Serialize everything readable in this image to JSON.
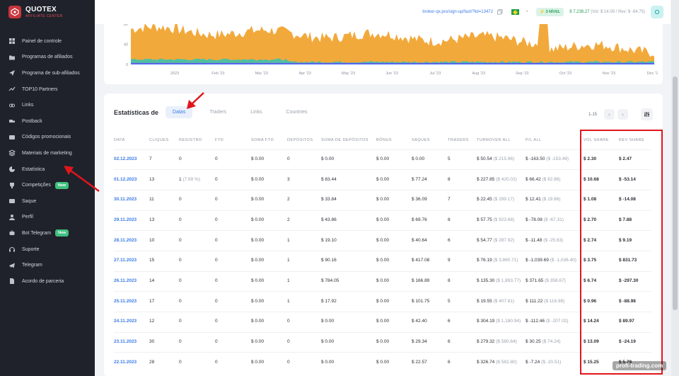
{
  "app": {
    "name": "QUOTEX",
    "subtitle": "AFFILIATE CENTER",
    "accent": "#c8353c"
  },
  "sidebar": {
    "items": [
      {
        "label": "Painel de controle",
        "icon": "dashboard-icon"
      },
      {
        "label": "Programas de afiliados",
        "icon": "folder-icon"
      },
      {
        "label": "Programa de sub-afiliados",
        "icon": "send-icon"
      },
      {
        "label": "TOP10 Partners",
        "icon": "trend-icon"
      },
      {
        "label": "Links",
        "icon": "link-icon"
      },
      {
        "label": "Postback",
        "icon": "truck-icon"
      },
      {
        "label": "Códigos promocionais",
        "icon": "promo-icon"
      },
      {
        "label": "Materiais de marketing",
        "icon": "stack-icon"
      },
      {
        "label": "Estatística",
        "icon": "pie-chart-icon"
      },
      {
        "label": "Competições",
        "icon": "trophy-icon",
        "badge": "New"
      },
      {
        "label": "Saque",
        "icon": "wallet-icon"
      },
      {
        "label": "Perfil",
        "icon": "user-icon"
      },
      {
        "label": "Bot Telegram",
        "icon": "bot-icon",
        "badge": "New"
      },
      {
        "label": "Suporte",
        "icon": "headset-icon"
      },
      {
        "label": "Telegram",
        "icon": "telegram-icon"
      },
      {
        "label": "Acordo de parceria",
        "icon": "document-icon"
      }
    ]
  },
  "topbar": {
    "ref_link": "broker-qx.pro/sign-up/fast/?lid=13472",
    "level": "3 NÍVEL",
    "balance": "$ 7,238.27",
    "balance_detail": "(Vol: $ 14.09 / Rev: $ -84.75)"
  },
  "chart_data": {
    "type": "area",
    "y_ticks": [
      "80",
      "40",
      "0"
    ],
    "ylim": [
      0,
      80
    ],
    "x_labels": [
      "2023",
      "Feb '23",
      "Mar '23",
      "Apr '23",
      "May '23",
      "Jun '23",
      "Jul '23",
      "Aug '23",
      "Sep '23",
      "Oct '23",
      "Nov '23",
      "Dec '2"
    ],
    "colors": {
      "orange": "#f2a93b",
      "teal": "#34c3b5",
      "purple": "#7a5fd6",
      "blue": "#3d6bff"
    }
  },
  "table": {
    "title": "Estatísticas de",
    "tabs": [
      "Datas",
      "Traders",
      "Links",
      "Countries"
    ],
    "pagination": "1-15",
    "columns": [
      "DATA",
      "CLIQUES",
      "REGISTRO",
      "FTD",
      "SOMA FTD",
      "DEPÓSITOS",
      "SOMA DE DEPÓSITOS",
      "BÔNUS",
      "SAQUES",
      "TRADERS",
      "TURNOVER ALL",
      "P/L ALL",
      "VOL SHARE",
      "REV SHARE"
    ],
    "rows": [
      {
        "date": "02.12.2023",
        "cliques": "7",
        "registro": "0",
        "registro_pct": "",
        "ftd": "0",
        "soma_ftd": "$ 0.00",
        "depositos": "0",
        "soma_dep": "$ 0.00",
        "bonus": "$ 0.00",
        "saques": "$ 0.00",
        "traders": "5",
        "turnover": "$ 50.54",
        "turnover_sub": "($ 215.96)",
        "pl": "$ -163.50",
        "pl_sub": "($ -153.49)",
        "vol": "$ 2.30",
        "rev": "$ 2.47"
      },
      {
        "date": "01.12.2023",
        "cliques": "13",
        "registro": "1",
        "registro_pct": "(7.69 %)",
        "ftd": "0",
        "soma_ftd": "$ 0.00",
        "depositos": "3",
        "soma_dep": "$ 83.44",
        "bonus": "$ 0.00",
        "saques": "$ 77.24",
        "traders": "8",
        "turnover": "$ 227.85",
        "turnover_sub": "($ 420.02)",
        "pl": "$ 66.42",
        "pl_sub": "($ 82.86)",
        "vol": "$ 10.68",
        "rev": "$ -53.14"
      },
      {
        "date": "30.11.2023",
        "cliques": "11",
        "registro": "0",
        "registro_pct": "",
        "ftd": "0",
        "soma_ftd": "$ 0.00",
        "depositos": "2",
        "soma_dep": "$ 33.84",
        "bonus": "$ 0.00",
        "saques": "$ 36.09",
        "traders": "7",
        "turnover": "$ 22.45",
        "turnover_sub": "($ 299.17)",
        "pl": "$ 12.41",
        "pl_sub": "($ 19.86)",
        "vol": "$ 1.08",
        "rev": "$ -14.08"
      },
      {
        "date": "29.11.2023",
        "cliques": "13",
        "registro": "0",
        "registro_pct": "",
        "ftd": "0",
        "soma_ftd": "$ 0.00",
        "depositos": "2",
        "soma_dep": "$ 43.86",
        "bonus": "$ 0.00",
        "saques": "$ 69.76",
        "traders": "8",
        "turnover": "$ 57.75",
        "turnover_sub": "($ 923.68)",
        "pl": "$ -78.08",
        "pl_sub": "($ -67.31)",
        "vol": "$ 2.70",
        "rev": "$ 7.88"
      },
      {
        "date": "28.11.2023",
        "cliques": "10",
        "registro": "0",
        "registro_pct": "",
        "ftd": "0",
        "soma_ftd": "$ 0.00",
        "depositos": "1",
        "soma_dep": "$ 19.10",
        "bonus": "$ 0.00",
        "saques": "$ 40.64",
        "traders": "6",
        "turnover": "$ 54.77",
        "turnover_sub": "($ 287.92)",
        "pl": "$ -11.48",
        "pl_sub": "($ -25.63)",
        "vol": "$ 2.74",
        "rev": "$ 9.19"
      },
      {
        "date": "27.11.2023",
        "cliques": "15",
        "registro": "0",
        "registro_pct": "",
        "ftd": "0",
        "soma_ftd": "$ 0.00",
        "depositos": "1",
        "soma_dep": "$ 90.16",
        "bonus": "$ 0.00",
        "saques": "$ 417.08",
        "traders": "9",
        "turnover": "$ 76.19",
        "turnover_sub": "($ 3,860.71)",
        "pl": "$ -1,039.69",
        "pl_sub": "($ -1,036.40)",
        "vol": "$ 3.75",
        "rev": "$ 831.73"
      },
      {
        "date": "26.11.2023",
        "cliques": "14",
        "registro": "0",
        "registro_pct": "",
        "ftd": "0",
        "soma_ftd": "$ 0.00",
        "depositos": "1",
        "soma_dep": "$ 784.05",
        "bonus": "$ 0.00",
        "saques": "$ 166.89",
        "traders": "8",
        "turnover": "$ 135.30",
        "turnover_sub": "($ 1,893.77)",
        "pl": "$ 371.65",
        "pl_sub": "($ 358.67)",
        "vol": "$ 6.74",
        "rev": "$ -297.30"
      },
      {
        "date": "25.11.2023",
        "cliques": "17",
        "registro": "0",
        "registro_pct": "",
        "ftd": "0",
        "soma_ftd": "$ 0.00",
        "depositos": "1",
        "soma_dep": "$ 17.92",
        "bonus": "$ 0.00",
        "saques": "$ 101.75",
        "traders": "5",
        "turnover": "$ 19.55",
        "turnover_sub": "($ 407.81)",
        "pl": "$ 111.22",
        "pl_sub": "($ 116.98)",
        "vol": "$ 0.96",
        "rev": "$ -88.98"
      },
      {
        "date": "24.11.2023",
        "cliques": "12",
        "registro": "0",
        "registro_pct": "",
        "ftd": "0",
        "soma_ftd": "$ 0.00",
        "depositos": "0",
        "soma_dep": "$ 0.00",
        "bonus": "$ 0.00",
        "saques": "$ 42.40",
        "traders": "6",
        "turnover": "$ 304.19",
        "turnover_sub": "($ 1,180.94)",
        "pl": "$ -112.46",
        "pl_sub": "($ -207.02)",
        "vol": "$ 14.24",
        "rev": "$ 89.97"
      },
      {
        "date": "23.11.2023",
        "cliques": "30",
        "registro": "0",
        "registro_pct": "",
        "ftd": "0",
        "soma_ftd": "$ 0.00",
        "depositos": "0",
        "soma_dep": "$ 0.00",
        "bonus": "$ 0.00",
        "saques": "$ 29.34",
        "traders": "6",
        "turnover": "$ 279.32",
        "turnover_sub": "($ 580.64)",
        "pl": "$ 30.25",
        "pl_sub": "($ 74.24)",
        "vol": "$ 13.09",
        "rev": "$ -24.19"
      },
      {
        "date": "22.11.2023",
        "cliques": "28",
        "registro": "0",
        "registro_pct": "",
        "ftd": "0",
        "soma_ftd": "$ 0.00",
        "depositos": "0",
        "soma_dep": "$ 0.00",
        "bonus": "$ 0.00",
        "saques": "$ 22.57",
        "traders": "6",
        "turnover": "$ 326.74",
        "turnover_sub": "($ 582.80)",
        "pl": "$ -7.24",
        "pl_sub": "($ -20.51)",
        "vol": "$ 15.25",
        "rev": "$ 5.79"
      }
    ]
  },
  "watermark": "profi-trading.com"
}
